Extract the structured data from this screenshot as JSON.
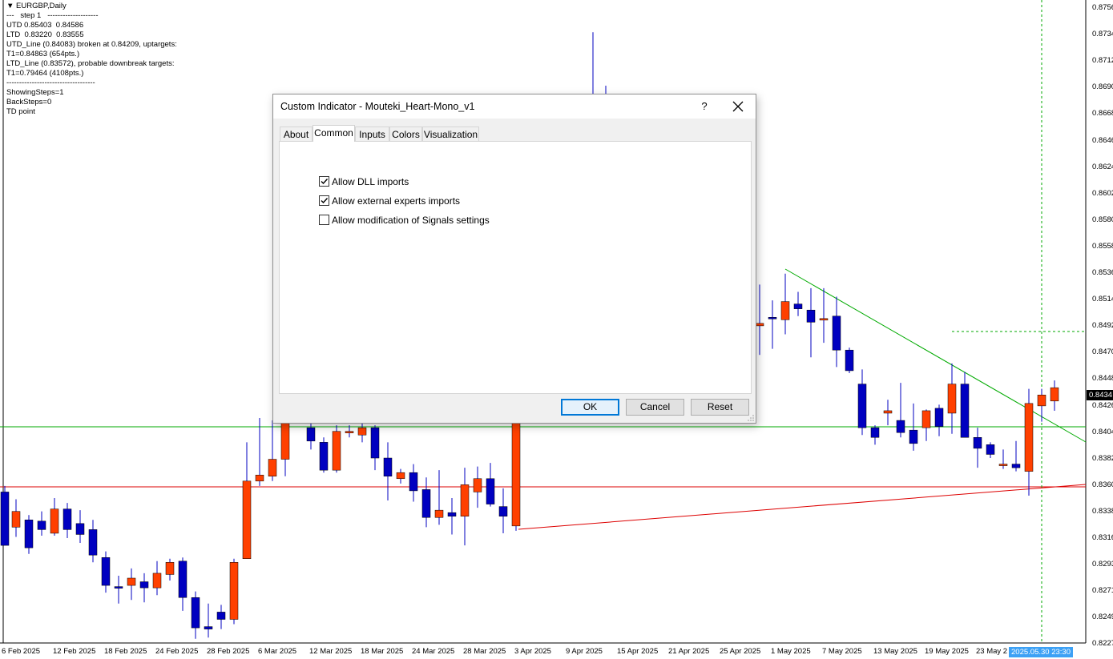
{
  "chart": {
    "symbol_label": "EURGBP,Daily",
    "info_lines": [
      "---   step 1   --------------------",
      "UTD 0.85403  0.84586",
      "LTD  0.83220  0.83555",
      "UTD_Line (0.84083) broken at 0.84209, uptargets:",
      "T1=0.84863 (654pts.)",
      "LTD_Line (0.83572), probable downbreak targets:",
      "T1=0.79464 (4108pts.)",
      "-----------------------------------",
      "ShowingSteps=1",
      "BackSteps=0",
      "TD point"
    ],
    "price_labels": [
      "0.8756",
      "0.8734",
      "0.8712",
      "0.8690",
      "0.8668",
      "0.8646",
      "0.8624",
      "0.8602",
      "0.8580",
      "0.8558",
      "0.8536",
      "0.8514",
      "0.8492",
      "0.8470",
      "0.8448",
      "0.8426",
      "0.8404",
      "0.8382",
      "0.8360",
      "0.8338",
      "0.8316",
      "0.8293",
      "0.8271",
      "0.8249",
      "0.8227"
    ],
    "current_price": "0.8434",
    "date_labels": [
      "6 Feb 2025",
      "12 Feb 2025",
      "18 Feb 2025",
      "24 Feb 2025",
      "28 Feb 2025",
      "6 Mar 2025",
      "12 Mar 2025",
      "18 Mar 2025",
      "24 Mar 2025",
      "28 Mar 2025",
      "3 Apr 2025",
      "9 Apr 2025",
      "15 Apr 2025",
      "21 Apr 2025",
      "25 Apr 2025",
      "1 May 2025",
      "7 May 2025",
      "13 May 2025",
      "19 May 2025",
      "23 May 2"
    ],
    "crosshair_time": "2025.05.30 23:30",
    "colors": {
      "bull": "#ff4000",
      "bear": "#0000c0",
      "support_line": "#dd0000",
      "resistance_line": "#00aa00",
      "axis_text": "#000000"
    }
  },
  "dialog": {
    "title": "Custom Indicator - Mouteki_Heart-Mono_v1",
    "help_label": "?",
    "close_icon": "close-icon",
    "tabs": [
      {
        "label": "About"
      },
      {
        "label": "Common"
      },
      {
        "label": "Inputs"
      },
      {
        "label": "Colors"
      },
      {
        "label": "Visualization"
      }
    ],
    "active_tab": "Common",
    "checkboxes": [
      {
        "label": "Allow DLL imports",
        "checked": true
      },
      {
        "label": "Allow external experts imports",
        "checked": true
      },
      {
        "label": "Allow modification of Signals settings",
        "checked": false
      }
    ],
    "buttons": {
      "ok": "OK",
      "cancel": "Cancel",
      "reset": "Reset"
    }
  }
}
